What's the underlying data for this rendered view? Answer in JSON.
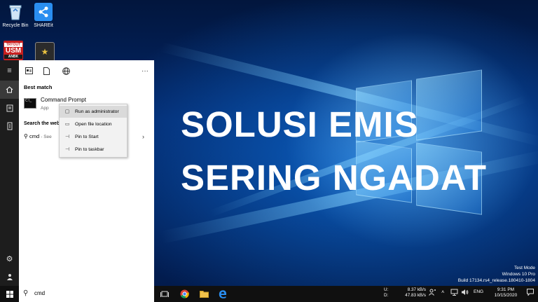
{
  "desktop": {
    "icons": [
      {
        "label": "Recycle Bin"
      },
      {
        "label": "SHAREit"
      },
      {
        "label": "USM",
        "badge_top": "TRYOUT",
        "badge_bottom": "ANBK"
      },
      {
        "label": ""
      }
    ]
  },
  "overlay": {
    "line1": "SOLUSI EMIS",
    "line2": "SERING NGADAT"
  },
  "watermark": {
    "line1": "Test Mode",
    "line2": "Windows 10 Pro",
    "line3": "Build 17134.rs4_release.180410-1804"
  },
  "start_menu": {
    "rail_icons": [
      "hamburger-icon",
      "home-icon",
      "documents-icon",
      "device-icon",
      "settings-icon",
      "user-icon"
    ],
    "tabs": [
      "all-tab-icon",
      "documents-tab-icon",
      "web-tab-icon"
    ],
    "more": "···",
    "best_match_heading": "Best match",
    "result": {
      "title": "Command Prompt",
      "subtitle": "App"
    },
    "search_web_heading": "Search the web",
    "web_query": "cmd",
    "web_see": "- See"
  },
  "context_menu": {
    "items": [
      {
        "label": "Run as administrator",
        "icon": "shield-icon"
      },
      {
        "label": "Open file location",
        "icon": "folder-icon"
      },
      {
        "label": "Pin to Start",
        "icon": "pin-icon"
      },
      {
        "label": "Pin to taskbar",
        "icon": "pin-icon"
      }
    ]
  },
  "taskbar": {
    "search_value": "cmd",
    "net": {
      "up_label": "U:",
      "up_value": "8.37 kB/s",
      "down_label": "D:",
      "down_value": "47.83 kB/s"
    },
    "language": "ENG",
    "time": "9:31 PM",
    "date": "10/15/2020"
  }
}
